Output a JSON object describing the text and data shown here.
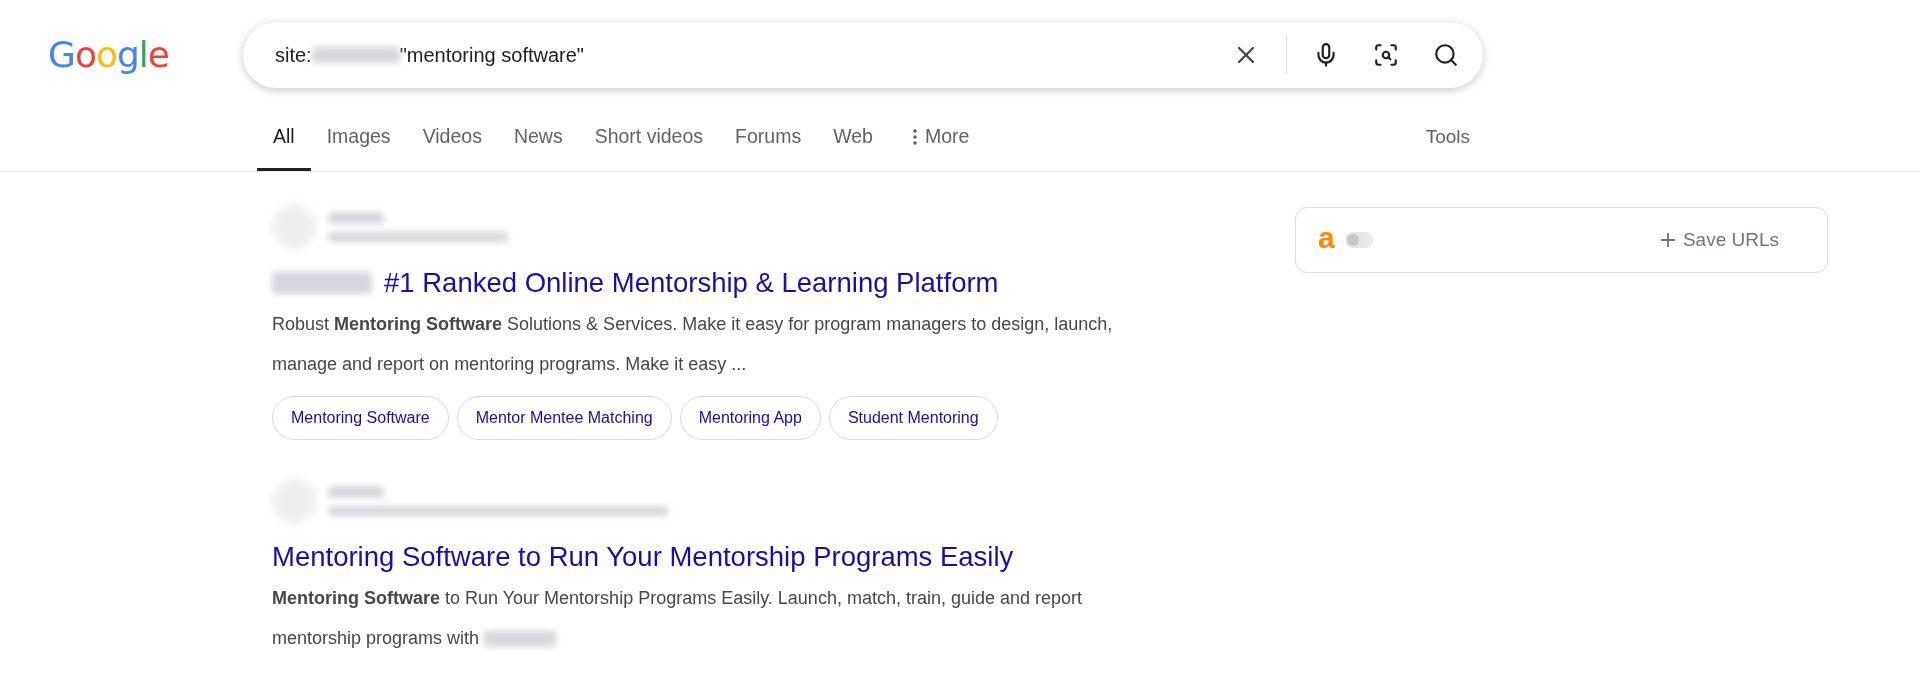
{
  "logo": "Google",
  "search": {
    "value_prefix": "site:",
    "value_suffix": "\"mentoring software\""
  },
  "tabs": [
    {
      "label": "All",
      "selected": true,
      "kind": "tab"
    },
    {
      "label": "Images",
      "selected": false,
      "kind": "tab"
    },
    {
      "label": "Videos",
      "selected": false,
      "kind": "tab"
    },
    {
      "label": "News",
      "selected": false,
      "kind": "tab"
    },
    {
      "label": "Short videos",
      "selected": false,
      "kind": "tab"
    },
    {
      "label": "Forums",
      "selected": false,
      "kind": "tab"
    },
    {
      "label": "Web",
      "selected": false,
      "kind": "tab"
    },
    {
      "label": "More",
      "selected": false,
      "kind": "menu"
    }
  ],
  "tools": "Tools",
  "results": [
    {
      "redacted_prefix": true,
      "title": "#1 Ranked Online Mentorship & Learning Platform",
      "snippet": "Robust **Mentoring Software** Solutions & Services. Make it easy for program managers to design, launch, manage and report on mentoring programs. Make it easy ...",
      "redacted_suffix": false,
      "chips": [
        "Mentoring Software",
        "Mentor Mentee Matching",
        "Mentoring App",
        "Student Mentoring"
      ]
    },
    {
      "redacted_prefix": false,
      "title": "Mentoring Software to Run Your Mentorship Programs Easily",
      "snippet": "**Mentoring Software** to Run Your Mentorship Programs Easily. Launch, match, train, guide and report mentorship programs with",
      "redacted_suffix": true
    }
  ],
  "extension": {
    "logo_letter": "a",
    "toggle_on": false,
    "save_button": "Save URLs"
  }
}
